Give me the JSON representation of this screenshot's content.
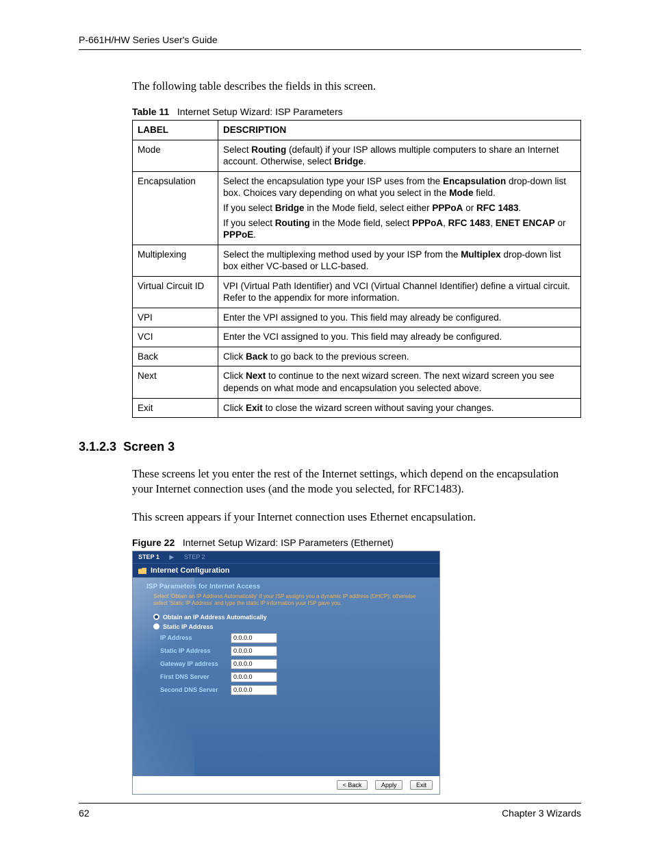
{
  "header": {
    "guide_title": "P-661H/HW Series User's Guide"
  },
  "intro": "The following table describes the fields in this screen.",
  "table_caption": {
    "label": "Table 11",
    "title": "Internet Setup Wizard: ISP Parameters"
  },
  "table": {
    "headers": [
      "LABEL",
      "DESCRIPTION"
    ],
    "rows": [
      {
        "label": "Mode",
        "desc": [
          [
            {
              "t": "Select "
            },
            {
              "b": "Routing"
            },
            {
              "t": " (default) if your ISP allows multiple computers to share an Internet account. Otherwise, select "
            },
            {
              "b": "Bridge"
            },
            {
              "t": "."
            }
          ]
        ]
      },
      {
        "label": "Encapsulation",
        "desc": [
          [
            {
              "t": "Select the encapsulation type your ISP uses from the "
            },
            {
              "b": "Encapsulation"
            },
            {
              "t": " drop-down list box. Choices vary depending on what you select in the "
            },
            {
              "b": "Mode"
            },
            {
              "t": " field."
            }
          ],
          [
            {
              "t": "If you select "
            },
            {
              "b": "Bridge"
            },
            {
              "t": " in the Mode field, select either "
            },
            {
              "b": "PPPoA"
            },
            {
              "t": " or "
            },
            {
              "b": "RFC 1483"
            },
            {
              "t": "."
            }
          ],
          [
            {
              "t": "If you select "
            },
            {
              "b": "Routing"
            },
            {
              "t": " in the Mode field, select "
            },
            {
              "b": "PPPoA"
            },
            {
              "t": ", "
            },
            {
              "b": "RFC 1483"
            },
            {
              "t": ", "
            },
            {
              "b": "ENET ENCAP"
            },
            {
              "t": " or "
            },
            {
              "b": "PPPoE"
            },
            {
              "t": "."
            }
          ]
        ]
      },
      {
        "label": "Multiplexing",
        "desc": [
          [
            {
              "t": "Select the multiplexing method used by your ISP from the "
            },
            {
              "b": "Multiplex"
            },
            {
              "t": " drop-down list box either VC-based or LLC-based."
            }
          ]
        ]
      },
      {
        "label": "Virtual Circuit ID",
        "desc": [
          [
            {
              "t": "VPI (Virtual Path Identifier) and VCI (Virtual Channel Identifier) define a virtual circuit. Refer to the appendix for more information."
            }
          ]
        ]
      },
      {
        "label": "VPI",
        "desc": [
          [
            {
              "t": "Enter the VPI assigned to you. This field may already be configured."
            }
          ]
        ]
      },
      {
        "label": "VCI",
        "desc": [
          [
            {
              "t": "Enter the VCI assigned to you. This field may already be configured."
            }
          ]
        ]
      },
      {
        "label": "Back",
        "desc": [
          [
            {
              "t": "Click "
            },
            {
              "b": "Back"
            },
            {
              "t": " to go back to the previous screen."
            }
          ]
        ]
      },
      {
        "label": "Next",
        "desc": [
          [
            {
              "t": "Click "
            },
            {
              "b": "Next"
            },
            {
              "t": " to continue to the next wizard screen. The next wizard screen you see depends on what mode and encapsulation you selected above."
            }
          ]
        ]
      },
      {
        "label": "Exit",
        "desc": [
          [
            {
              "t": "Click "
            },
            {
              "b": "Exit"
            },
            {
              "t": " to close the wizard screen without saving your changes."
            }
          ]
        ]
      }
    ]
  },
  "section": {
    "number": "3.1.2.3",
    "title": "Screen 3"
  },
  "para1": "These screens let you enter the rest of the Internet settings, which depend on the encapsulation your Internet connection uses (and the mode you selected, for RFC1483).",
  "para2": "This screen appears if your Internet connection uses Ethernet encapsulation.",
  "figure_caption": {
    "label": "Figure 22",
    "title": "Internet Setup Wizard: ISP Parameters (Ethernet)"
  },
  "wizard": {
    "steps": {
      "active": "STEP 1",
      "inactive": "STEP 2",
      "arrow": "▶"
    },
    "title": "Internet Configuration",
    "section": "ISP Parameters for Internet Access",
    "help": "Select 'Obtain an IP Address Automatically' if your ISP assigns you a dynamic IP address (DHCP); otherwise select 'Static IP Address' and type the static IP information your ISP gave you.",
    "radio": {
      "auto": "Obtain an IP Address Automatically",
      "static": "Static IP Address"
    },
    "fields": [
      {
        "label": "IP Address",
        "value": "0.0.0.0"
      },
      {
        "label": "Static IP Address",
        "value": "0.0.0.0"
      },
      {
        "label": "Gateway IP address",
        "value": "0.0.0.0"
      },
      {
        "label": "First DNS Server",
        "value": "0.0.0.0"
      },
      {
        "label": "Second DNS Server",
        "value": "0.0.0.0"
      }
    ],
    "buttons": {
      "back": "< Back",
      "apply": "Apply",
      "exit": "Exit"
    }
  },
  "footer": {
    "page": "62",
    "chapter": "Chapter 3 Wizards"
  }
}
